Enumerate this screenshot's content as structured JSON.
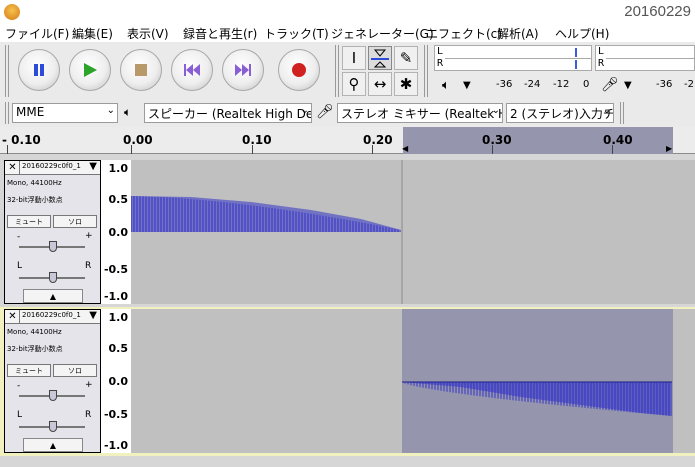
{
  "window": {
    "title": "20160229"
  },
  "menu": [
    "ファイル(F)",
    "編集(E)",
    "表示(V)",
    "録音と再生(r)",
    "トラック(T)",
    "ジェネレーター(G)",
    "エフェクト(c)",
    "解析(A)",
    "ヘルプ(H)"
  ],
  "transport": {
    "pause": "pause-icon",
    "play": "play-icon",
    "stop": "stop-icon",
    "skip_start": "skip-to-start-icon",
    "skip_end": "skip-to-end-icon",
    "record": "record-icon"
  },
  "meters": {
    "left_channel": "L",
    "right_channel": "R",
    "playback_ticks": [
      "-36",
      "-24",
      "-12",
      "0"
    ],
    "record_ticks": [
      "-36",
      "-2"
    ]
  },
  "devices": {
    "host": "MME",
    "output": "スピーカー (Realtek High Def",
    "input": "ステレオ ミキサー (Realtek Hig",
    "channels": "2 (ステレオ)入力チ"
  },
  "ruler": {
    "labels": [
      "- 0.10",
      "0.00",
      "0.10",
      "0.20",
      "0.30",
      "0.40"
    ]
  },
  "tracks": [
    {
      "name": "20160229c0f0_1",
      "rate": "Mono, 44100Hz",
      "format": "32-bit浮動小数点",
      "mute": "ミュート",
      "solo": "ソロ",
      "gain_minus": "-",
      "gain_plus": "+",
      "pan_left": "L",
      "pan_right": "R",
      "scale": [
        "1.0",
        "0.5",
        "0.0",
        "-0.5",
        "-1.0"
      ]
    },
    {
      "name": "20160229c0f0_1",
      "rate": "Mono, 44100Hz",
      "format": "32-bit浮動小数点",
      "mute": "ミュート",
      "solo": "ソロ",
      "gain_minus": "-",
      "gain_plus": "+",
      "pan_left": "L",
      "pan_right": "R",
      "scale": [
        "1.0",
        "0.5",
        "0.0",
        "-0.5",
        "-1.0"
      ]
    }
  ],
  "colors": {
    "waveform": "#3232c8",
    "selection": "#9595ad",
    "track_bg": "#c0c0c0",
    "record_red": "#d02020",
    "play_green": "#2aa52a"
  }
}
